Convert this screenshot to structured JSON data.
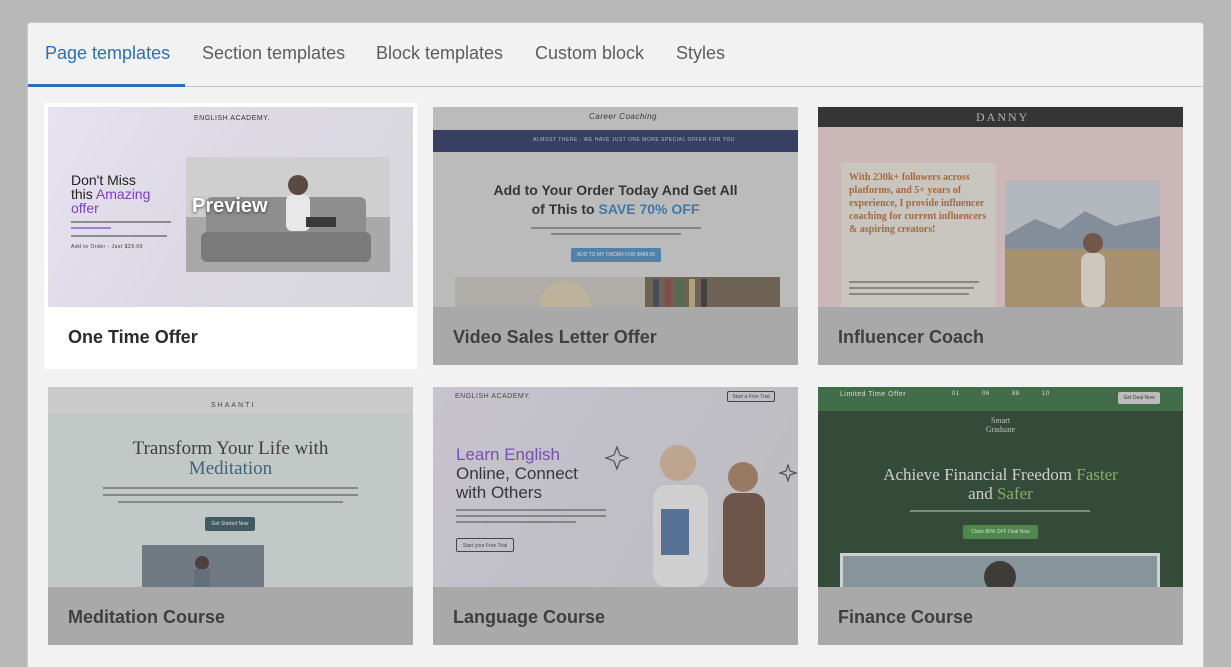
{
  "tabs": [
    {
      "label": "Page templates",
      "active": true
    },
    {
      "label": "Section templates",
      "active": false
    },
    {
      "label": "Block templates",
      "active": false
    },
    {
      "label": "Custom block",
      "active": false
    },
    {
      "label": "Styles",
      "active": false
    }
  ],
  "preview_label": "Preview",
  "cards": [
    {
      "label": "One Time Offer",
      "thumb": {
        "brand": "ENGLISH ACADEMY.",
        "headline_1": "Don't Miss",
        "headline_2": "this ",
        "headline_accent": "Amazing",
        "headline_3": "offer",
        "cta": "Add to Order - Just $29.00"
      }
    },
    {
      "label": "Video Sales Letter Offer",
      "thumb": {
        "brand": "Career Coaching",
        "banner": "ALMOST THERE - WE HAVE JUST ONE MORE SPECIAL OFFER FOR YOU",
        "headline_1": "Add to Your Order Today And Get All",
        "headline_2": "of This to ",
        "headline_accent": "SAVE 70% OFF",
        "cta": "ADD TO MY ORDER FOR $499.00"
      }
    },
    {
      "label": "Influencer Coach",
      "thumb": {
        "brand": "DANNY",
        "quote": "With 230k+ followers across platforms, and 5+ years of experience, I provide influencer coaching for current influencers & aspiring creators!"
      }
    },
    {
      "label": "Meditation Course",
      "thumb": {
        "brand": "SHAANTI",
        "headline_1": "Transform Your Life with",
        "headline_2": "Meditation",
        "cta": "Get Started Now"
      }
    },
    {
      "label": "Language Course",
      "thumb": {
        "brand": "ENGLISH ACADEMY.",
        "top_button": "Start a Free Trial",
        "headline_accent": "Learn English",
        "headline_2": "Online, Connect",
        "headline_3": "with Others",
        "cta": "Start your Free Trial"
      }
    },
    {
      "label": "Finance Course",
      "thumb": {
        "ribbon": "Limited Time Offer",
        "countdown": [
          "01",
          "06",
          "88",
          "10"
        ],
        "top_button": "Get Deal Now",
        "brand_1": "Smart",
        "brand_2": "Graduate",
        "headline_1": "Achieve Financial Freedom ",
        "headline_accent_1": "Faster",
        "headline_2": "and ",
        "headline_accent_2": "Safer",
        "cta": "Claim 80% OFF Deal Now"
      }
    }
  ],
  "colors": {
    "accent": "#2a6fb8",
    "purple": "#7b3fc9",
    "navy": "#1f2a5c",
    "finance_green": "#1c3b22"
  }
}
